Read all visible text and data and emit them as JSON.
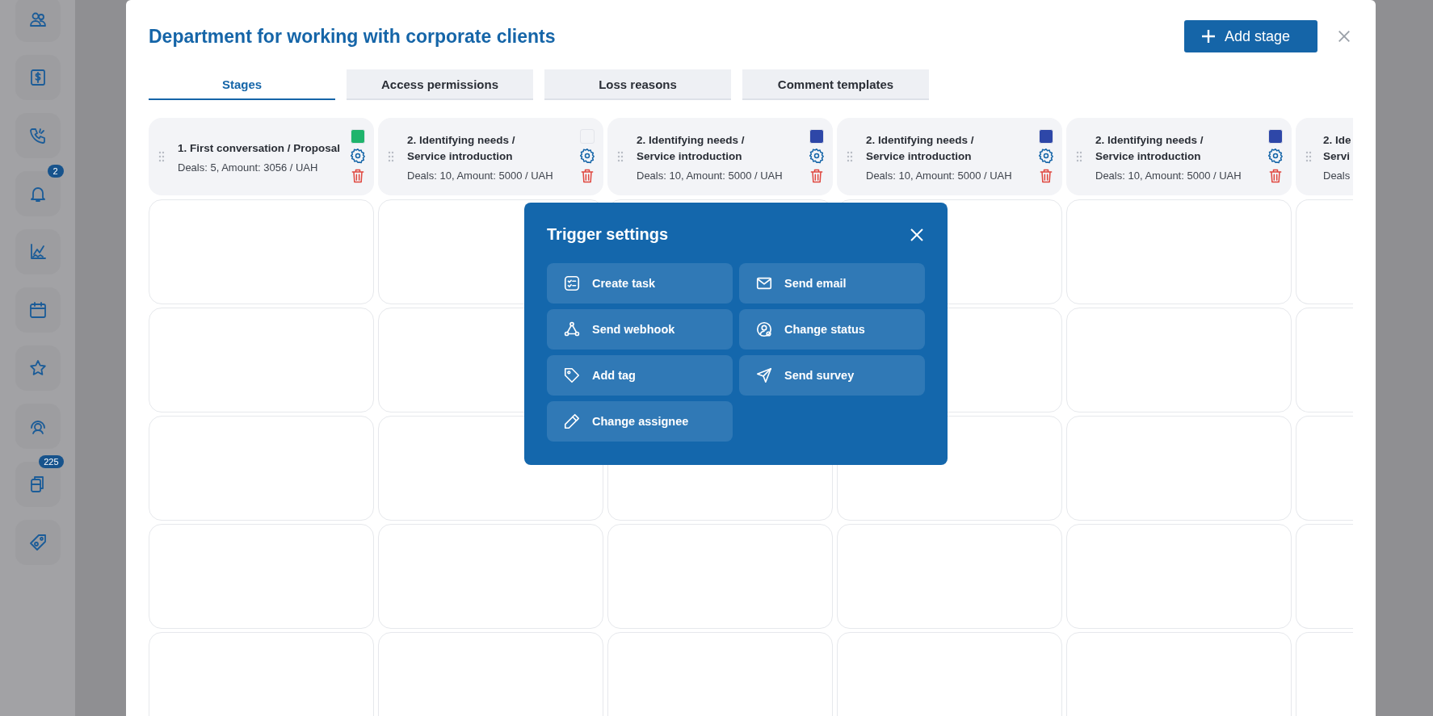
{
  "sidebar": {
    "badges": [
      "2",
      "225"
    ]
  },
  "dialog": {
    "title": "Department for working with corporate clients",
    "add_button": "Add stage",
    "tabs": [
      {
        "label": "Stages",
        "selected": true
      },
      {
        "label": "Access permissions",
        "selected": false
      },
      {
        "label": "Loss reasons",
        "selected": false
      },
      {
        "label": "Comment templates",
        "selected": false
      }
    ],
    "stages": [
      {
        "kind": "full",
        "title_lines": [
          "1. First conversation / Proposal"
        ],
        "summary": "Deals: 5, Amount: 3056 / UAH",
        "color": "#1fb46c"
      },
      {
        "kind": "full",
        "title_lines": [
          "2. Identifying needs /",
          "Service introduction"
        ],
        "summary": "Deals: 10, Amount: 5000 / UAH",
        "color": "#f3f4f7"
      },
      {
        "kind": "full",
        "title_lines": [
          "2. Identifying needs /",
          "Service introduction"
        ],
        "summary": "Deals: 10, Amount: 5000 / UAH",
        "color": "#2e47a8"
      },
      {
        "kind": "full",
        "title_lines": [
          "2. Identifying needs /",
          "Service introduction"
        ],
        "summary": "Deals: 10, Amount: 5000 / UAH",
        "color": "#2e47a8"
      },
      {
        "kind": "full",
        "title_lines": [
          "2. Identifying needs /",
          "Service introduction"
        ],
        "summary": "Deals: 10, Amount: 5000 / UAH",
        "color": "#2e47a8"
      },
      {
        "kind": "cut",
        "title_lines": [
          "2. Ide",
          "Servi"
        ],
        "summary": "Deals"
      }
    ]
  },
  "trigger_settings": {
    "title": "Trigger settings",
    "actions": [
      "Create task",
      "Send email",
      "Send webhook",
      "Change status",
      "Add tag",
      "Send survey",
      "Change assignee"
    ]
  }
}
